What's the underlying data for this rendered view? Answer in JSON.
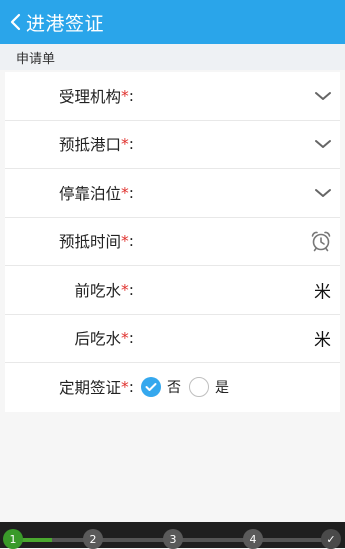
{
  "header": {
    "title": "进港签证",
    "back_icon": "chevron-left-icon"
  },
  "section": {
    "label": "申请单"
  },
  "form": {
    "fields": [
      {
        "label": "受理机构",
        "required": "*",
        "colon": ":",
        "control": "dropdown",
        "icon": "chevron-down-icon"
      },
      {
        "label": "预抵港口",
        "required": "*",
        "colon": ":",
        "control": "dropdown",
        "icon": "chevron-down-icon"
      },
      {
        "label": "停靠泊位",
        "required": "*",
        "colon": ":",
        "control": "dropdown",
        "icon": "chevron-down-icon"
      },
      {
        "label": "预抵时间",
        "required": "*",
        "colon": ":",
        "control": "datetime",
        "icon": "alarm-clock-icon"
      },
      {
        "label": "前吃水",
        "required": "*",
        "colon": ":",
        "control": "number",
        "unit": "米"
      },
      {
        "label": "后吃水",
        "required": "*",
        "colon": ":",
        "control": "number",
        "unit": "米"
      },
      {
        "label": "定期签证",
        "required": "*",
        "colon": ":",
        "control": "radio",
        "options": [
          {
            "label": "否",
            "selected": true
          },
          {
            "label": "是",
            "selected": false
          }
        ]
      }
    ]
  },
  "progress": {
    "current_step": 1,
    "steps": [
      "1",
      "2",
      "3",
      "4",
      "✓"
    ],
    "fill_fraction": 0.12,
    "colors": {
      "active": "#3a9a2a",
      "inactive": "#5a5a5a"
    }
  },
  "colors": {
    "header": "#2aa5ea",
    "required": "#e0322e",
    "radio_on": "#35a8ee"
  }
}
